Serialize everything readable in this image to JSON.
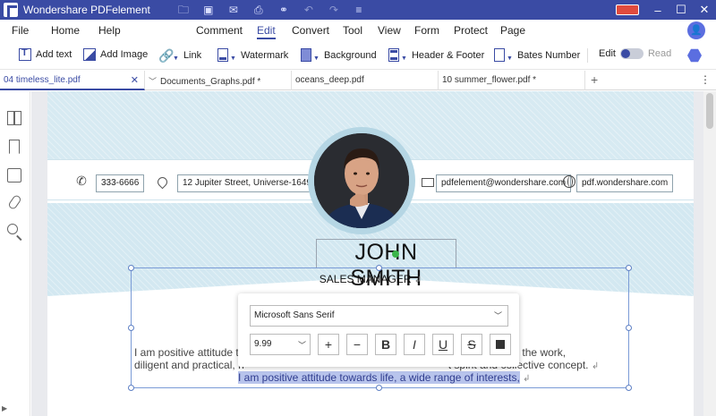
{
  "app": {
    "title": "Wondershare PDFelement"
  },
  "menu": {
    "items": [
      "File",
      "Home",
      "Help",
      "Comment",
      "Edit",
      "Convert",
      "Tool",
      "View",
      "Form",
      "Protect",
      "Page"
    ],
    "active": "Edit"
  },
  "toolbar": {
    "add_text": "Add text",
    "add_image": "Add Image",
    "link": "Link",
    "watermark": "Watermark",
    "background": "Background",
    "header_footer": "Header & Footer",
    "bates_number": "Bates Number",
    "edit": "Edit",
    "read": "Read",
    "mode": "edit"
  },
  "tabs": [
    {
      "label": "04 timeless_lite.pdf",
      "active": true
    },
    {
      "label": "Documents_Graphs.pdf *",
      "active": false
    },
    {
      "label": "oceans_deep.pdf",
      "active": false
    },
    {
      "label": "10 summer_flower.pdf *",
      "active": false
    }
  ],
  "document": {
    "phone": "333-6666",
    "address": "12 Jupiter Street, Universe-1649",
    "email": "pdfelement@wondershare.com",
    "website": "pdf.wondershare.com",
    "name": "JOHN SMITH",
    "role": "SALES MANAGER",
    "para_line1_start": "I am positive attitude t",
    "para_line1_end": "onsibility for the work,",
    "para_line2_start": "diligent and practical, h",
    "para_line2_end": "t spirit and collective concept.",
    "para_line3": "I am positive attitude towards life, a wide range of interests,",
    "colors": {
      "band": "#d7eaf2",
      "accent": "#3a4ba4",
      "highlight": "#b8c4ec"
    }
  },
  "font_popup": {
    "font_family": "Microsoft Sans Serif",
    "font_size": "9.99",
    "buttons": [
      "plus-icon",
      "minus-icon",
      "bold-icon",
      "italic-icon",
      "underline-icon",
      "strikethrough-icon",
      "color-swatch"
    ],
    "plus": "+",
    "minus": "−",
    "bold": "B",
    "italic": "I",
    "underline": "U",
    "strike": "S"
  }
}
